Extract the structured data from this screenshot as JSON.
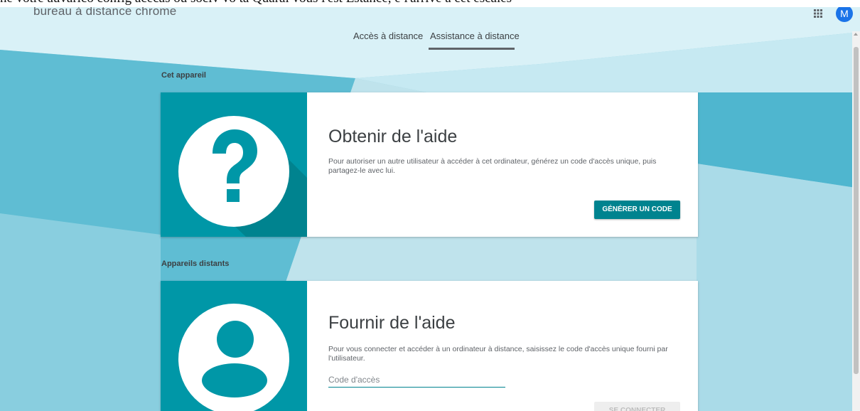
{
  "overlay": {
    "text": "ne votre auvarico config acecas ou sociv vo ta Quarai vous l'est Estance, e l'arrive a cet escales"
  },
  "header": {
    "app_title": "bureau à distance chrome",
    "apps_icon": "apps-grid-icon",
    "avatar_letter": "M",
    "avatar_color": "#1a73e8"
  },
  "tabs": [
    {
      "label": "Accès à distance",
      "active": false
    },
    {
      "label": "Assistance à distance",
      "active": true
    }
  ],
  "sections": {
    "this_device": {
      "label": "Cet appareil",
      "card": {
        "icon": "question-mark-icon",
        "title": "Obtenir de l'aide",
        "description": "Pour autoriser un autre utilisateur à accéder à cet ordinateur, générez un code d'accès unique, puis partagez-le avec lui.",
        "button_label": "GÉNÉRER UN CODE"
      }
    },
    "remote_devices": {
      "label": "Appareils distants",
      "card": {
        "icon": "person-icon",
        "title": "Fournir de l'aide",
        "description": "Pour vous connecter et accéder à un ordinateur à distance, saisissez le code d'accès unique fourni par l'utilisateur.",
        "input_placeholder": "Code d'accès",
        "button_label": "SE CONNECTER"
      }
    }
  },
  "colors": {
    "accent": "#0097a7",
    "button": "#00838f",
    "background": "#bfe3ec"
  }
}
